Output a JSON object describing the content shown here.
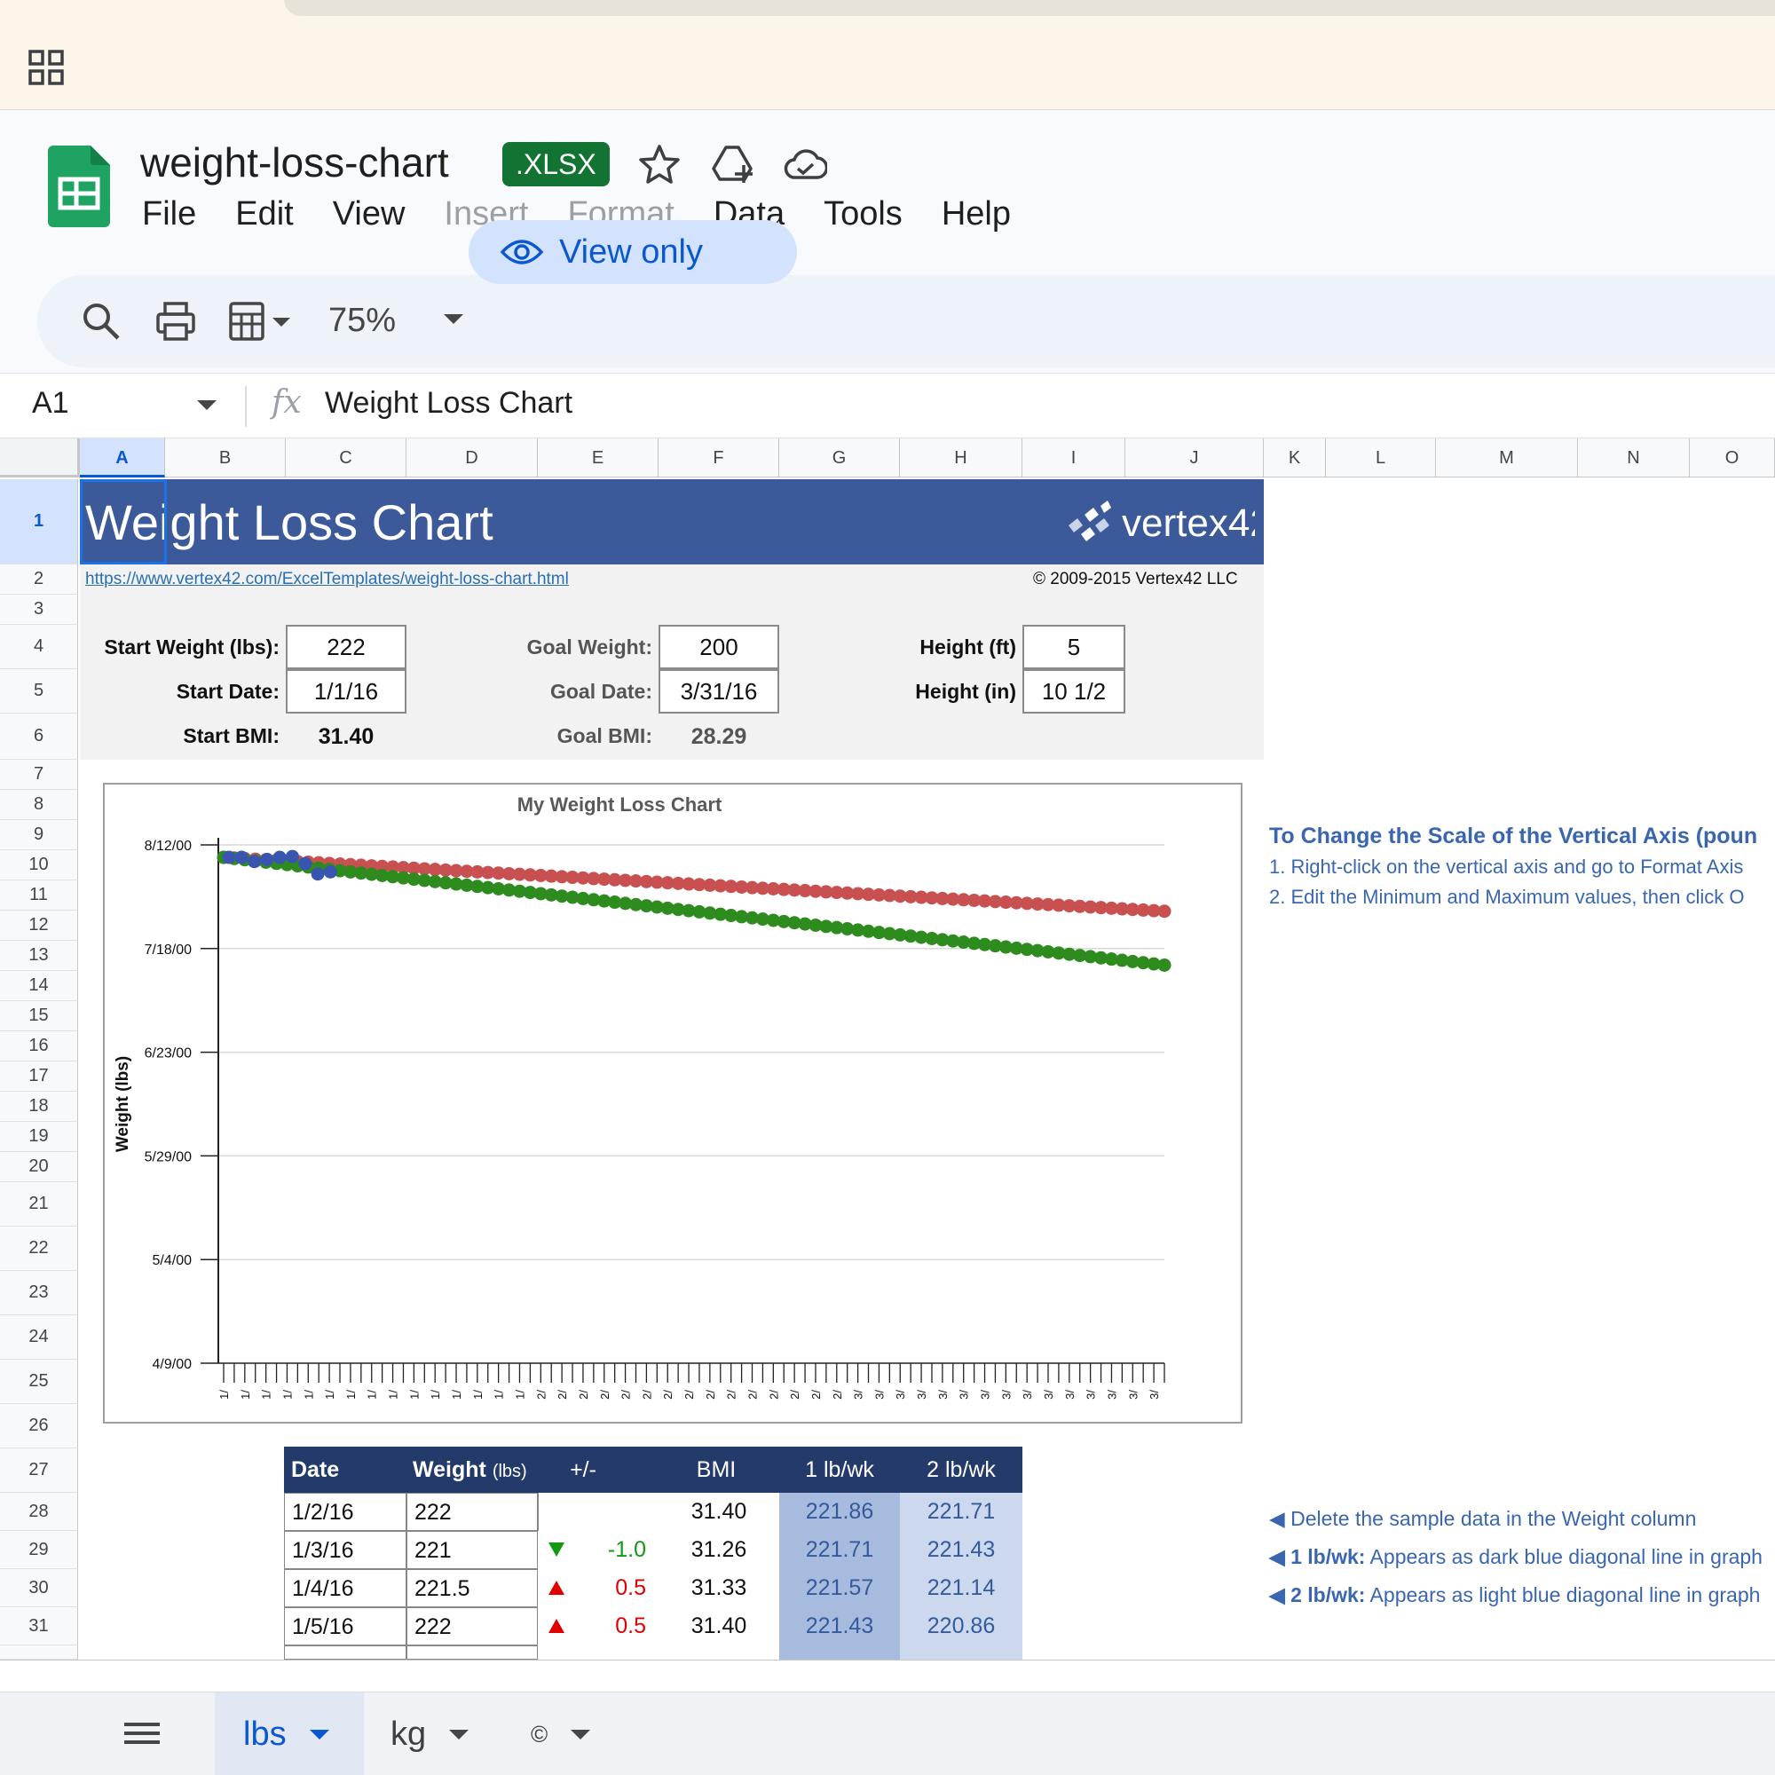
{
  "app": {
    "doc_title": "weight-loss-chart",
    "file_badge": ".XLSX",
    "menus": [
      "File",
      "Edit",
      "View",
      "Insert",
      "Format",
      "Data",
      "Tools",
      "Help"
    ],
    "disabled_menus": [
      "Insert",
      "Format"
    ],
    "zoom": "75%",
    "view_only_label": "View only"
  },
  "formula_bar": {
    "cell_ref": "A1",
    "fx": "fx",
    "value": "Weight Loss Chart"
  },
  "columns": [
    "A",
    "B",
    "C",
    "D",
    "E",
    "F",
    "G",
    "H",
    "I",
    "J",
    "K",
    "L",
    "M",
    "N",
    "O"
  ],
  "rows": [
    "1",
    "2",
    "3",
    "4",
    "5",
    "6",
    "7",
    "8",
    "9",
    "10",
    "11",
    "12",
    "13",
    "14",
    "15",
    "16",
    "17",
    "18",
    "19",
    "20",
    "21",
    "22",
    "23",
    "24",
    "25",
    "26",
    "27",
    "28",
    "29",
    "30",
    "31"
  ],
  "sheet": {
    "title": "Weight Loss Chart",
    "logo_text": "vertex42",
    "link": "https://www.vertex42.com/ExcelTemplates/weight-loss-chart.html",
    "copyright": "© 2009-2015 Vertex42 LLC",
    "start_weight_label": "Start Weight (lbs):",
    "start_weight": "222",
    "start_date_label": "Start Date:",
    "start_date": "1/1/16",
    "start_bmi_label": "Start BMI:",
    "start_bmi": "31.40",
    "goal_weight_label": "Goal Weight:",
    "goal_weight": "200",
    "goal_date_label": "Goal Date:",
    "goal_date": "3/31/16",
    "goal_bmi_label": "Goal BMI:",
    "goal_bmi": "28.29",
    "height_ft_label": "Height (ft)",
    "height_ft": "5",
    "height_in_label": "Height (in)",
    "height_in": "10 1/2"
  },
  "instructions": {
    "title": "To Change the Scale of the Vertical Axis (poun",
    "step1": "1. Right-click on the vertical axis and go to Format Axis",
    "step2": "2. Edit the Minimum and Maximum values, then click O",
    "note1": "◀ Delete the sample data in the Weight column",
    "note2_bold": "◀ 1 lb/wk:",
    "note2": " Appears as dark blue diagonal line in graph",
    "note3_bold": "◀ 2 lb/wk:",
    "note3": " Appears as light blue diagonal line in graph"
  },
  "table": {
    "headers": [
      "Date",
      "Weight",
      "(lbs)",
      "+/-",
      "BMI",
      "1 lb/wk",
      "2 lb/wk"
    ],
    "rows": [
      {
        "date": "1/2/16",
        "weight": "222",
        "change": "",
        "dir": "",
        "bmi": "31.40",
        "w1": "221.86",
        "w2": "221.71"
      },
      {
        "date": "1/3/16",
        "weight": "221",
        "change": "-1.0",
        "dir": "down",
        "bmi": "31.26",
        "w1": "221.71",
        "w2": "221.43"
      },
      {
        "date": "1/4/16",
        "weight": "221.5",
        "change": "0.5",
        "dir": "up",
        "bmi": "31.33",
        "w1": "221.57",
        "w2": "221.14"
      },
      {
        "date": "1/5/16",
        "weight": "222",
        "change": "0.5",
        "dir": "up",
        "bmi": "31.40",
        "w1": "221.43",
        "w2": "220.86"
      }
    ]
  },
  "sheet_tabs": [
    {
      "label": "lbs",
      "active": true
    },
    {
      "label": "kg",
      "active": false
    },
    {
      "label": "©",
      "active": false
    }
  ],
  "colors": {
    "banner": "#3c5a99",
    "table_header": "#243a6b",
    "series_1lb": "#c85050",
    "series_2lb": "#2e8b1e",
    "series_actual": "#3a55b0",
    "accent": "#0b57d0"
  },
  "chart_data": {
    "type": "scatter",
    "title": "My Weight Loss Chart",
    "ylabel": "Weight (lbs)",
    "y_tick_labels": [
      "8/12/00",
      "7/18/00",
      "6/23/00",
      "5/29/00",
      "5/4/00",
      "4/9/00"
    ],
    "ylim": [
      100,
      225
    ],
    "x_range": [
      "1/1/16",
      "3/31/16"
    ],
    "x_tick_labels": [
      "1/",
      "2/",
      "3/"
    ],
    "series": [
      {
        "start": 222,
        "end": 209,
        "color": "#c85050"
      },
      {
        "start": 222,
        "end": 196,
        "color": "#2e8b1e"
      },
      {
        "values": [
          222,
          222,
          221,
          221.5,
          222,
          222.2,
          220.5,
          218,
          218.5
        ],
        "color": "#3a55b0"
      }
    ]
  }
}
